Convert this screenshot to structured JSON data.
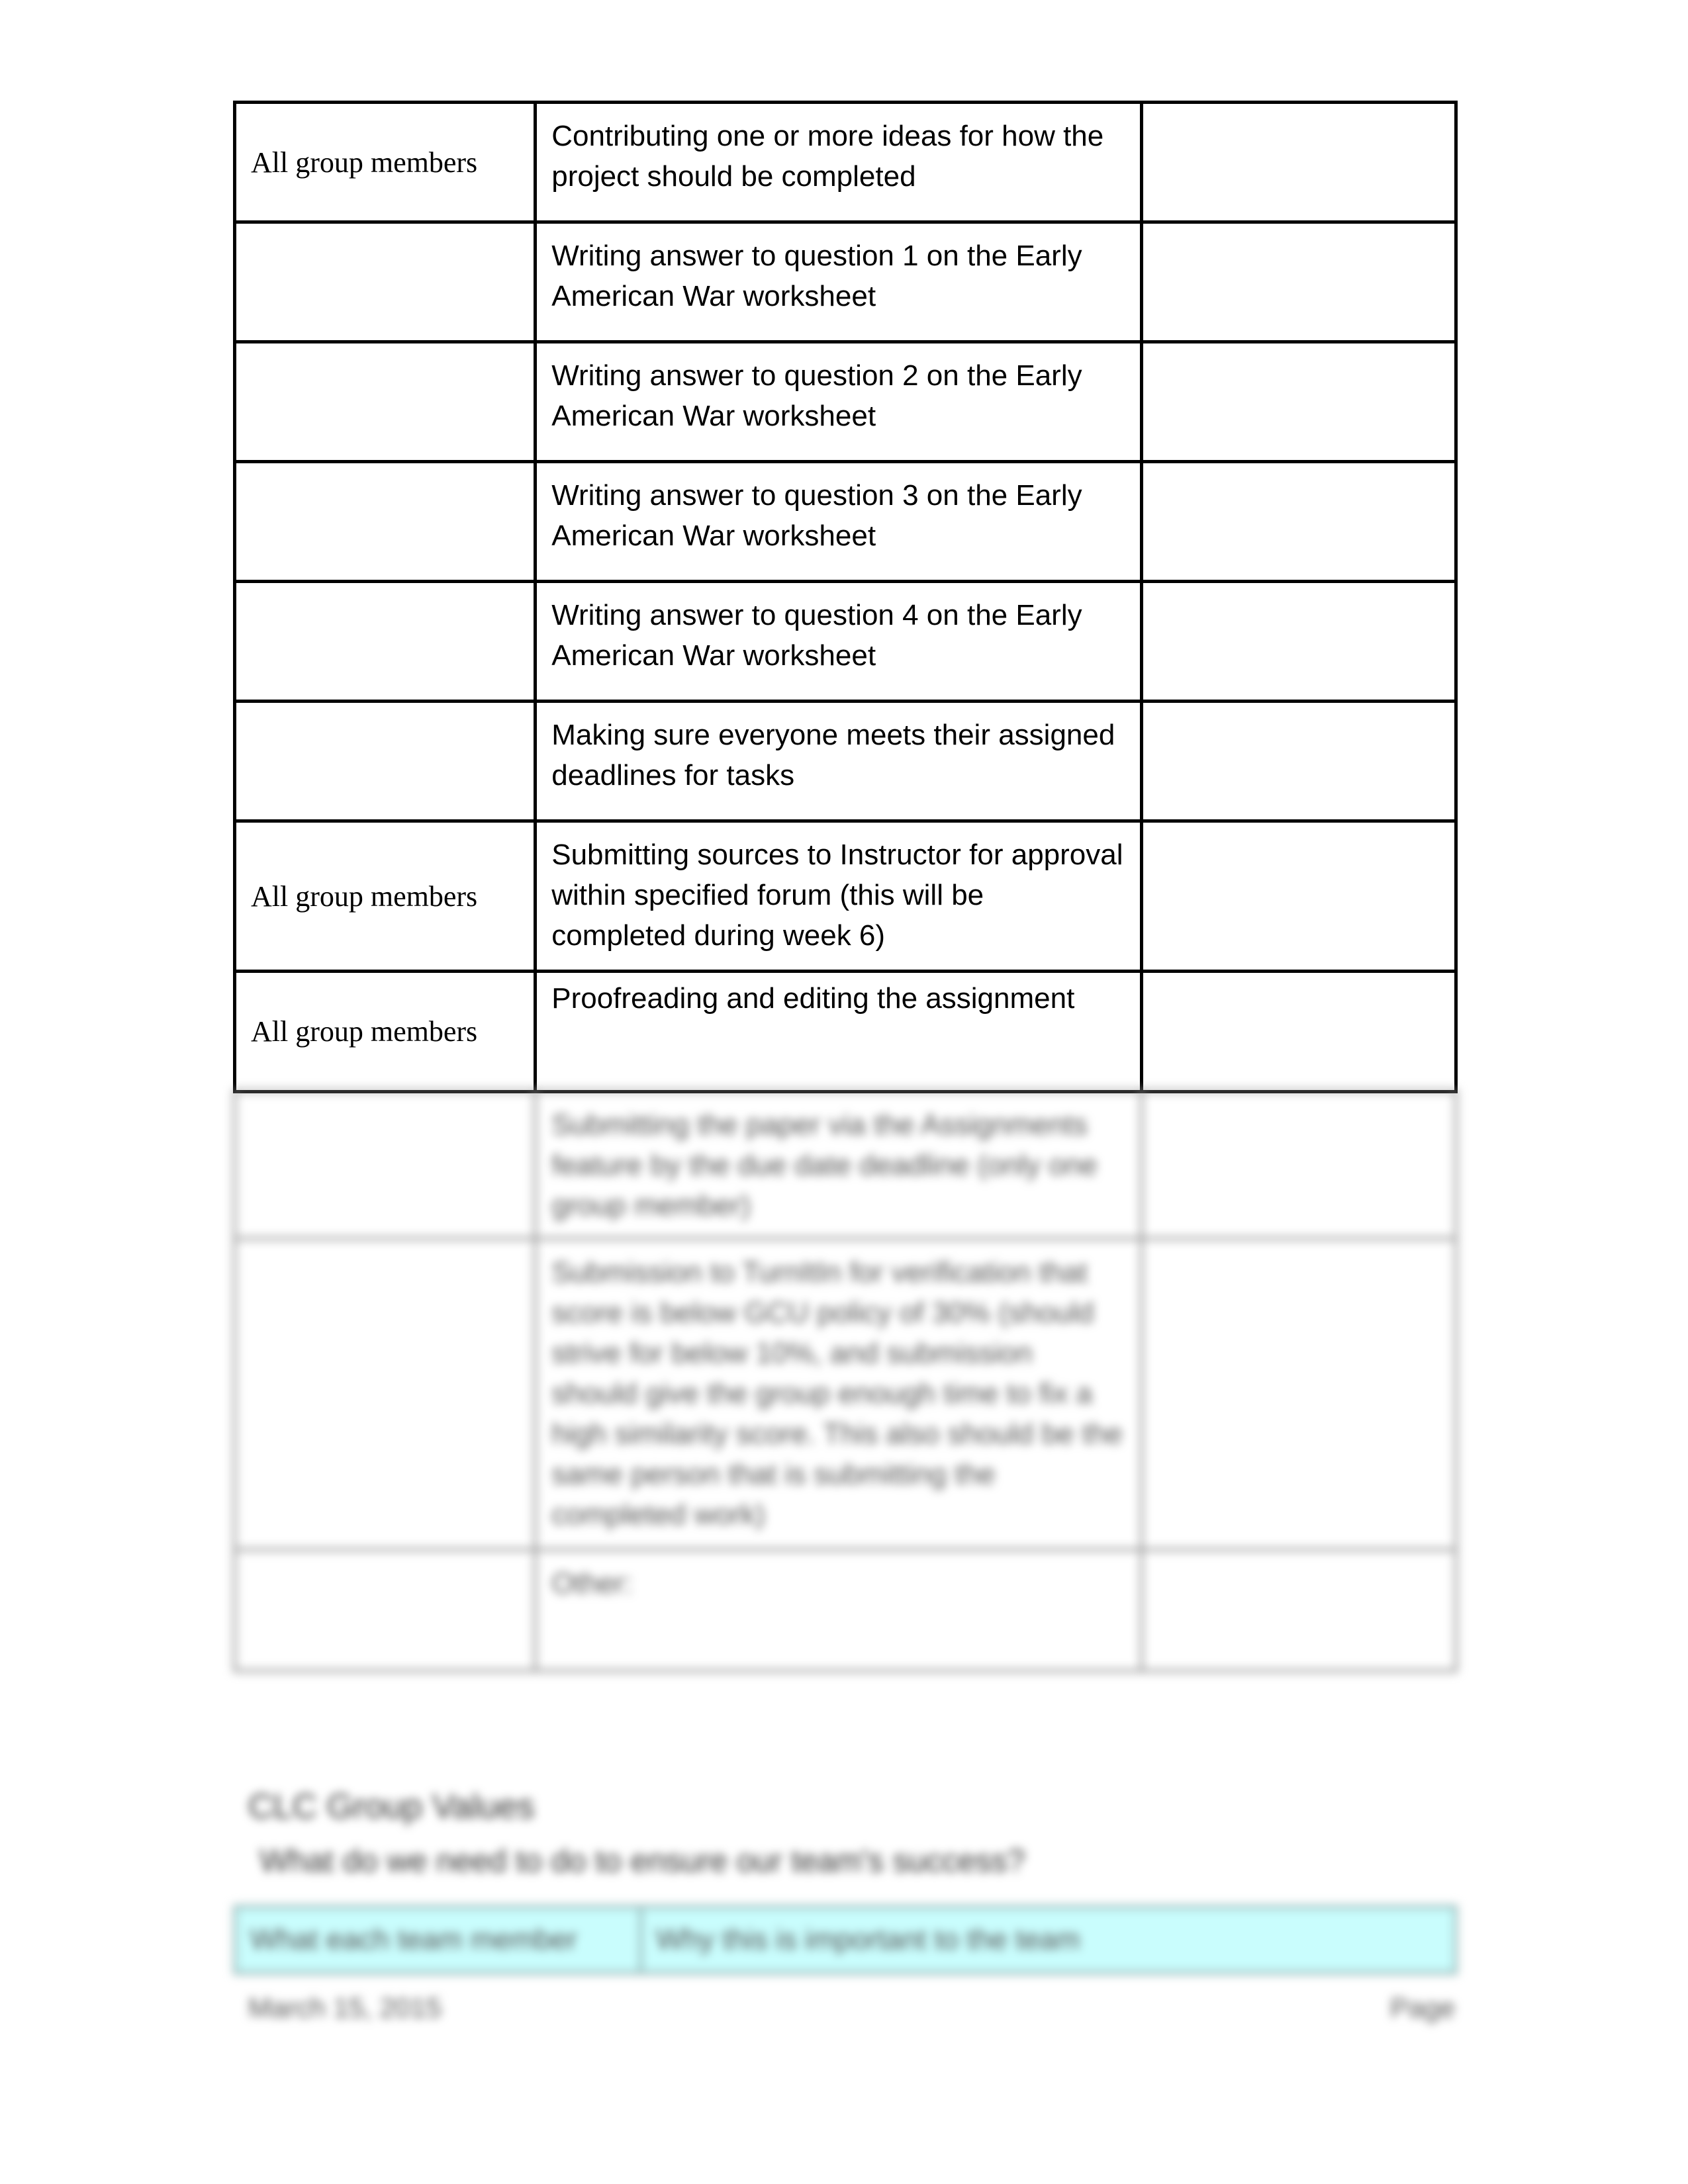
{
  "responsibility_table": {
    "rows": [
      {
        "member": "All group members",
        "task": "Contributing one or more ideas for how the project should be completed",
        "notes": ""
      },
      {
        "member": "",
        "task": "Writing answer to question 1 on the Early American War worksheet",
        "notes": ""
      },
      {
        "member": "",
        "task": "Writing answer to question 2 on the Early American War worksheet",
        "notes": ""
      },
      {
        "member": "",
        "task": "Writing answer to question 3 on the Early American War worksheet",
        "notes": ""
      },
      {
        "member": "",
        "task": "Writing answer to question 4 on the Early American War worksheet",
        "notes": ""
      },
      {
        "member": "",
        "task": "Making sure everyone meets their assigned deadlines for tasks",
        "notes": ""
      },
      {
        "member": "All group members",
        "task": "Submitting sources to Instructor for approval within specified forum (this will be completed during week 6)",
        "notes": ""
      },
      {
        "member": "All group members",
        "task": "Proofreading and editing the assignment",
        "notes": ""
      },
      {
        "member": "",
        "task": "Submitting the paper via the Assignments feature by the due date deadline (only one group member)",
        "notes": ""
      },
      {
        "member": "",
        "task": "Submission to TurnItIn for verification that score is below GCU policy of 30% (should strive for below 10%, and submission should give the group enough time to fix a high similarity score.  This also should be the same person that is submitting the completed work)",
        "notes": ""
      },
      {
        "member": "",
        "task": "Other:",
        "notes": ""
      }
    ]
  },
  "values_section": {
    "heading": "CLC Group Values",
    "question": "What do we need to do to ensure our team's success?",
    "header_col1": "What each team member",
    "header_col2": "Why this is important to the team",
    "header_color": "#c9fdfd"
  },
  "footer": {
    "date": "March 15, 2015",
    "page_label": "Page"
  }
}
